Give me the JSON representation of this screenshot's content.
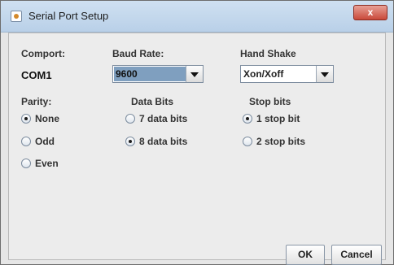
{
  "window": {
    "title": "Serial Port Setup",
    "close_glyph": "x"
  },
  "comport": {
    "label": "Comport:",
    "value": "COM1"
  },
  "baud": {
    "label": "Baud Rate:",
    "value": "9600"
  },
  "handshake": {
    "label": "Hand Shake",
    "value": "Xon/Xoff"
  },
  "parity": {
    "label": "Parity:",
    "options": [
      "None",
      "Odd",
      "Even"
    ],
    "selected": "None"
  },
  "data_bits": {
    "label": "Data Bits",
    "options": [
      "7 data bits",
      "8 data bits"
    ],
    "selected": "8 data bits"
  },
  "stop_bits": {
    "label": "Stop bits",
    "options": [
      "1 stop bit",
      "2 stop bits"
    ],
    "selected": "1 stop bit"
  },
  "buttons": {
    "ok": "OK",
    "cancel": "Cancel"
  },
  "colors": {
    "titlebar": "#c4d8ee",
    "close": "#c9493a",
    "selected_field": "#7f9fbf",
    "panel": "#ececec"
  }
}
